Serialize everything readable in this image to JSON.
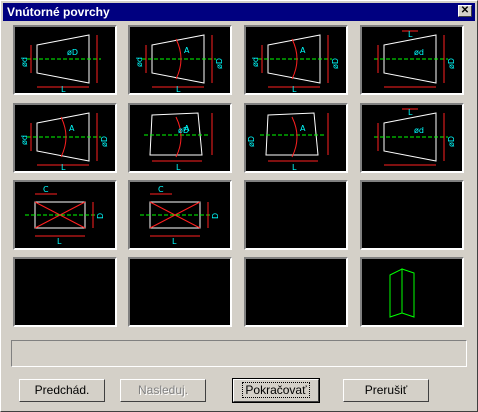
{
  "window": {
    "title": "Vnútorné povrchy",
    "close_glyph": "✕"
  },
  "colors": {
    "line": "#ffffff",
    "dim": "#ff2020",
    "text": "#00ffff",
    "axis": "#00ff00"
  },
  "grid": {
    "tiles": [
      {
        "kind": "frustum-left",
        "labels": [
          "ød",
          "øD",
          "L"
        ]
      },
      {
        "kind": "frustum-left-angle",
        "labels": [
          "ød",
          "A",
          "øD",
          "L"
        ]
      },
      {
        "kind": "frustum-left-angle",
        "labels": [
          "ød",
          "A",
          "øD",
          "L"
        ]
      },
      {
        "kind": "frustum-steps",
        "labels": [
          "L",
          "ød",
          "øD"
        ]
      },
      {
        "kind": "frustum-left-angle",
        "labels": [
          "ød",
          "A",
          "øD",
          "L"
        ]
      },
      {
        "kind": "frustum-top",
        "labels": [
          "A",
          "øD",
          "L"
        ]
      },
      {
        "kind": "frustum-top-right",
        "labels": [
          "øD",
          "A",
          "L"
        ]
      },
      {
        "kind": "frustum-cylinder",
        "labels": [
          "L",
          "ød",
          "øD"
        ]
      },
      {
        "kind": "box",
        "labels": [
          "C",
          "D",
          "L"
        ]
      },
      {
        "kind": "box",
        "labels": [
          "C",
          "D",
          "L"
        ]
      },
      {
        "kind": "empty",
        "labels": []
      },
      {
        "kind": "empty",
        "labels": []
      },
      {
        "kind": "empty",
        "labels": []
      },
      {
        "kind": "empty",
        "labels": []
      },
      {
        "kind": "empty",
        "labels": []
      },
      {
        "kind": "book",
        "labels": []
      }
    ]
  },
  "status": {
    "text": ""
  },
  "buttons": {
    "prev": "Predchád.",
    "next": "Nasleduj.",
    "continue": "Pokračovať",
    "cancel": "Prerušiť"
  }
}
